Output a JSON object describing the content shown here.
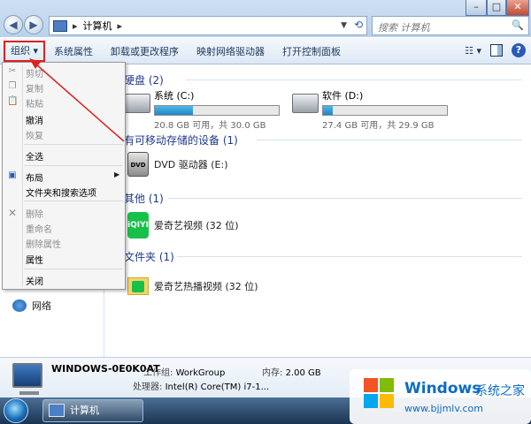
{
  "window": {
    "breadcrumb": "计算机",
    "search_placeholder": "搜索 计算机",
    "controls": [
      "–",
      "□",
      "✕"
    ]
  },
  "toolbar": {
    "organize": "组织 ▾",
    "items": [
      "系统属性",
      "卸载或更改程序",
      "映射网络驱动器",
      "打开控制面板"
    ]
  },
  "groups": {
    "hdd": "硬盘 (2)",
    "removable": "有可移动存储的设备 (1)",
    "other": "其他 (1)",
    "folders": "文件夹 (1)"
  },
  "drives": [
    {
      "name": "系统 (C:)",
      "free_text": "20.8 GB 可用，共 30.0 GB",
      "used_fraction": 0.31
    },
    {
      "name": "软件 (D:)",
      "free_text": "27.4 GB 可用，共 29.9 GB",
      "used_fraction": 0.08
    }
  ],
  "items": {
    "dvd": "DVD 驱动器 (E:)",
    "dvd_icon_text": "DVD",
    "iqiyi": "爱奇艺视频 (32 位)",
    "iqiyi_icon_text": "iQIYI",
    "iqiyi_folder": "爱奇艺热播视频 (32 位)"
  },
  "nav": {
    "network": "网络"
  },
  "menu": {
    "items": [
      {
        "label": "剪切",
        "enabled": false
      },
      {
        "label": "复制",
        "enabled": false
      },
      {
        "label": "粘贴",
        "enabled": false
      },
      {
        "label": "撤消",
        "enabled": true
      },
      {
        "label": "恢复",
        "enabled": false
      },
      {
        "label": "全选",
        "enabled": true
      },
      {
        "label": "布局",
        "enabled": true,
        "submenu": true
      },
      {
        "label": "文件夹和搜索选项",
        "enabled": true
      },
      {
        "label": "删除",
        "enabled": false
      },
      {
        "label": "重命名",
        "enabled": false
      },
      {
        "label": "删除属性",
        "enabled": false
      },
      {
        "label": "属性",
        "enabled": true
      },
      {
        "label": "关闭",
        "enabled": true
      }
    ]
  },
  "details": {
    "computer_name": "WINDOWS-0E0K0AT",
    "workgroup_label": "工作组:",
    "workgroup_value": "WorkGroup",
    "memory_label": "内存:",
    "memory_value": "2.00 GB",
    "cpu_label": "处理器:",
    "cpu_value": "Intel(R) Core(TM) i7-1..."
  },
  "taskbar": {
    "task_label": "计算机"
  },
  "watermark": {
    "word": "Windows",
    "cn": "系统之家",
    "url": "www.bjjmlv.com"
  },
  "colors": {
    "accent": "#1e86c5",
    "highlight_red": "#e02020"
  }
}
